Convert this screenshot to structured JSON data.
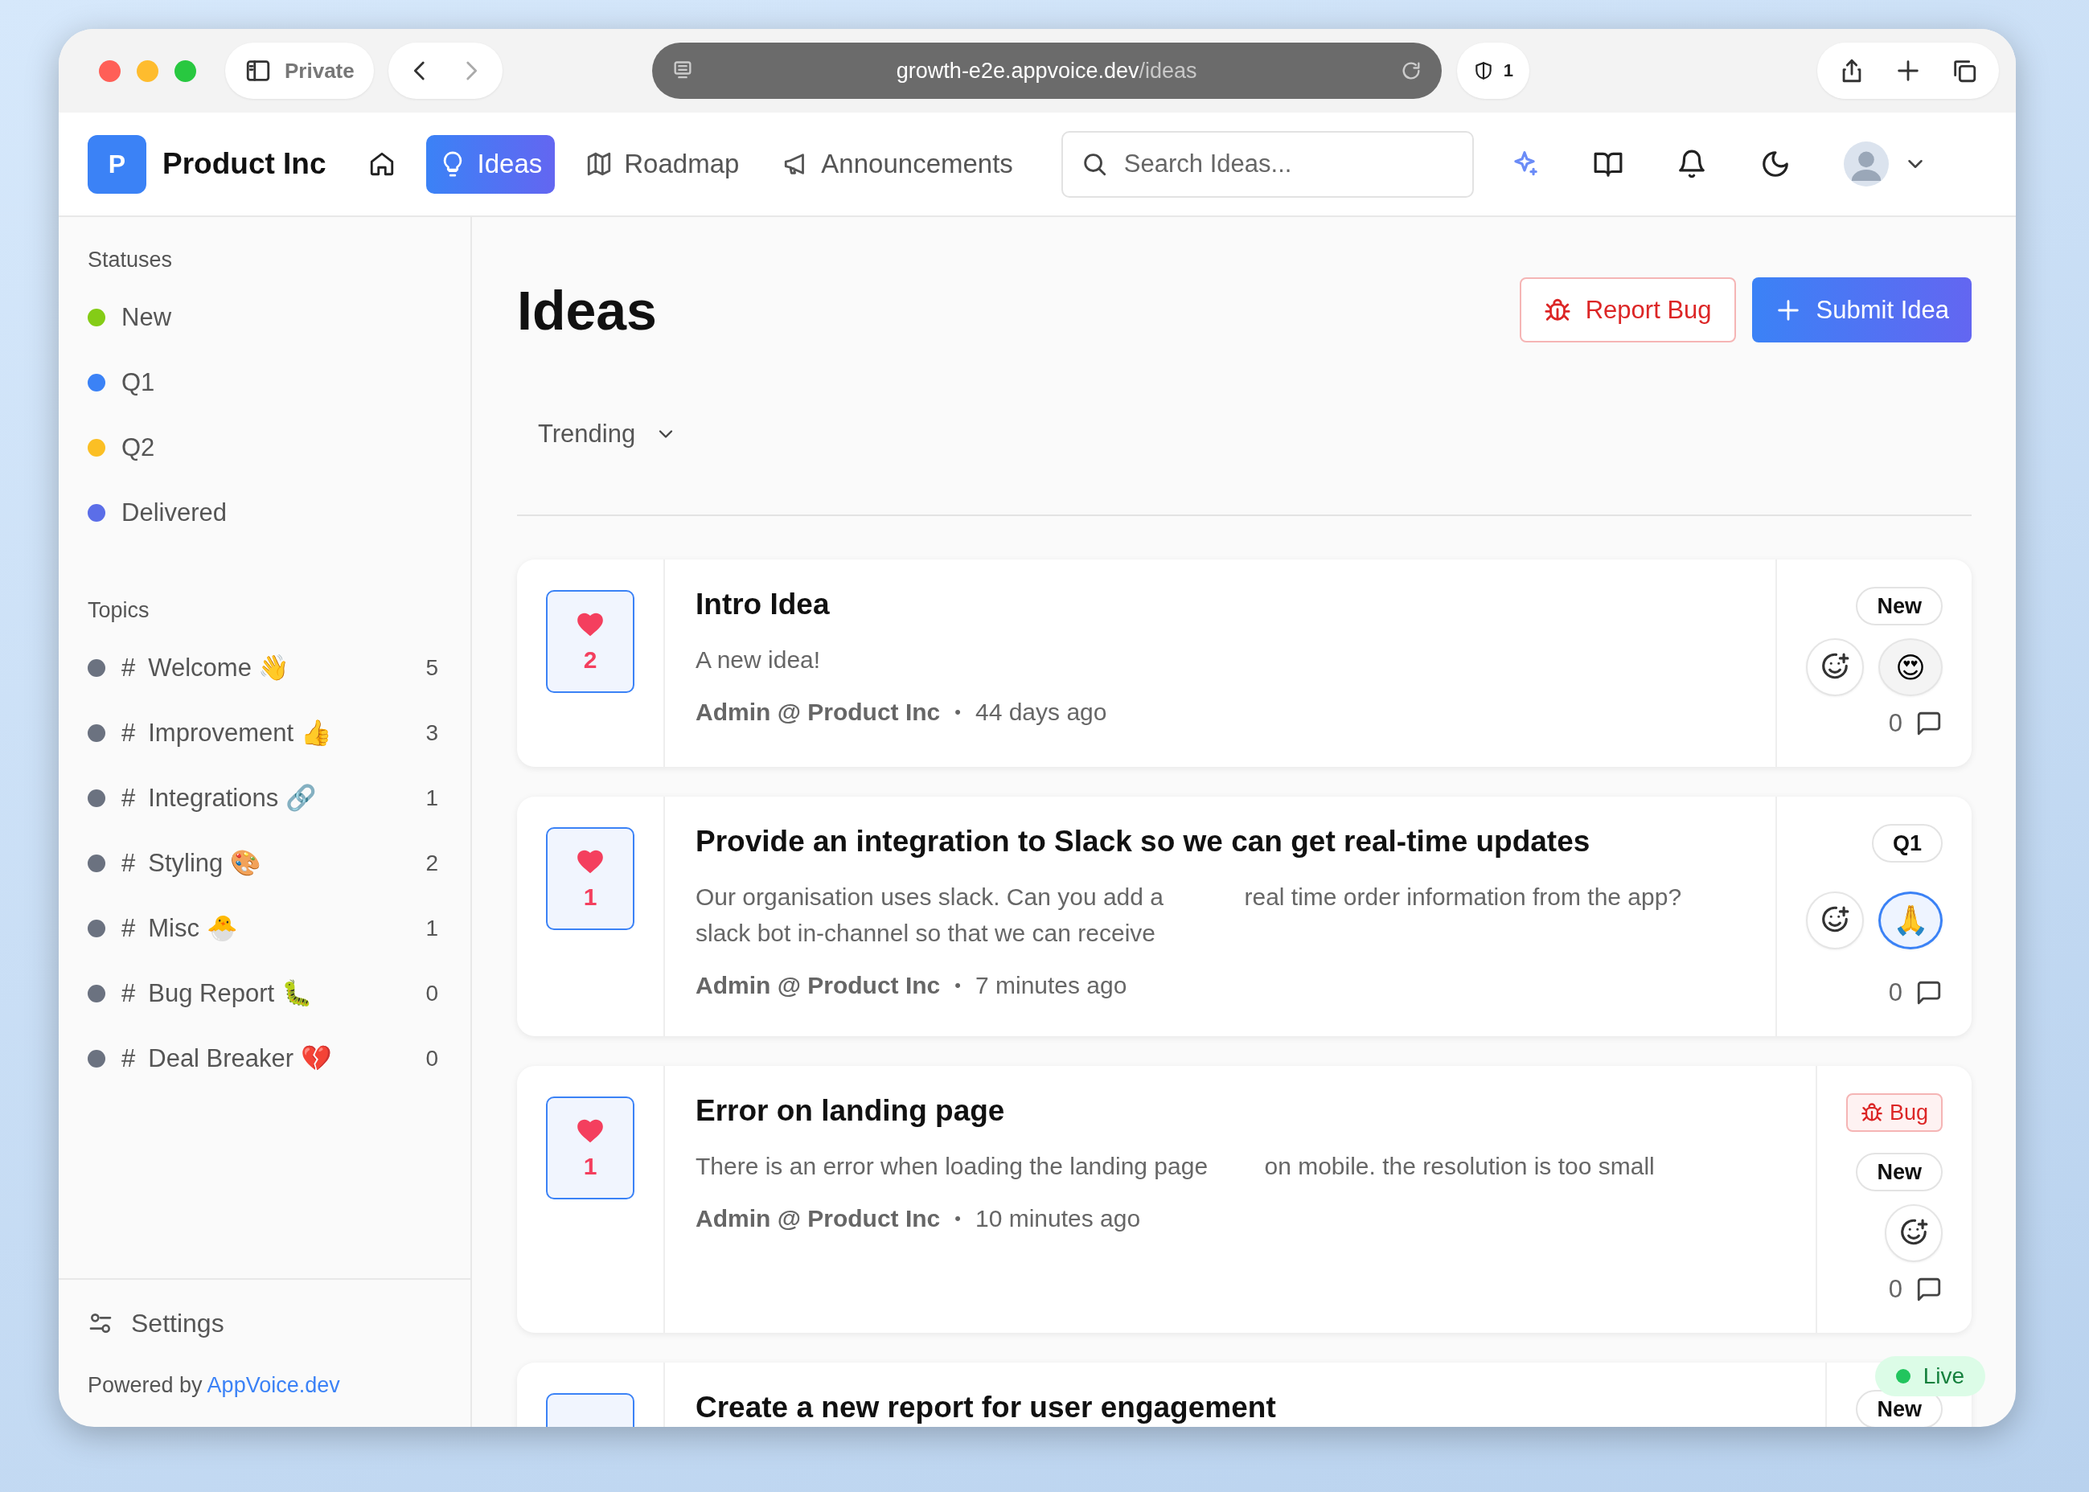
{
  "browser": {
    "private_label": "Private",
    "url_host": "growth-e2e.appvoice.dev",
    "url_path": "/ideas",
    "shield_count": "1"
  },
  "header": {
    "logo_letter": "P",
    "brand": "Product Inc",
    "nav": [
      {
        "kind": "home",
        "selected": false
      },
      {
        "kind": "ideas",
        "label": "Ideas",
        "selected": true
      },
      {
        "kind": "roadmap",
        "label": "Roadmap",
        "selected": false
      },
      {
        "kind": "announcements",
        "label": "Announcements",
        "selected": false
      }
    ],
    "search": {
      "placeholder": "Search Ideas..."
    }
  },
  "sidebar": {
    "statuses_heading": "Statuses",
    "statuses": [
      {
        "label": "New",
        "color": "#84cc16"
      },
      {
        "label": "Q1",
        "color": "#3b82f6"
      },
      {
        "label": "Q2",
        "color": "#fbbf24"
      },
      {
        "label": "Delivered",
        "color": "#5b6ee8"
      }
    ],
    "topics_heading": "Topics",
    "topics": [
      {
        "prefix": "#",
        "label": "Welcome 👋",
        "count": "5"
      },
      {
        "prefix": "#",
        "label": "Improvement 👍",
        "count": "3"
      },
      {
        "prefix": "#",
        "label": "Integrations 🔗",
        "count": "1"
      },
      {
        "prefix": "#",
        "label": "Styling 🎨",
        "count": "2"
      },
      {
        "prefix": "#",
        "label": "Misc 🐣",
        "count": "1"
      },
      {
        "prefix": "#",
        "label": "Bug Report 🐛",
        "count": "0"
      },
      {
        "prefix": "#",
        "label": "Deal Breaker 💔",
        "count": "0"
      }
    ],
    "settings": "Settings",
    "powered_by": "Powered by",
    "powered_by_link": "AppVoice.dev"
  },
  "page": {
    "title": "Ideas",
    "actions": [
      {
        "kind": "bug",
        "label": "Report Bug"
      },
      {
        "kind": "submit",
        "label": "Submit Idea"
      }
    ],
    "sort": "Trending"
  },
  "ideas": [
    {
      "votes": "2",
      "voted": true,
      "title": "Intro Idea",
      "description": "A new idea!",
      "author": "Admin @ Product Inc",
      "separator": "•",
      "time": "44 days ago",
      "tags": [
        {
          "kind": "status",
          "label": "New"
        }
      ],
      "reactions": [
        {
          "emoji": "😍",
          "selected": false
        }
      ],
      "comments": "0"
    },
    {
      "votes": "1",
      "voted": true,
      "title": "Provide an integration to Slack so we can get real-time updates",
      "description": "Our organisation uses slack. Can you add a slack bot in-channel so that we can receive real time order information from the app?",
      "author": "Admin @ Product Inc",
      "separator": "•",
      "time": "7 minutes ago",
      "tags": [
        {
          "kind": "status",
          "label": "Q1"
        }
      ],
      "reactions": [
        {
          "emoji": "🙏",
          "selected": true
        }
      ],
      "comments": "0"
    },
    {
      "votes": "1",
      "voted": true,
      "title": "Error on landing page",
      "description": "There is an error when loading the landing page on mobile. the resolution is too small",
      "author": "Admin @ Product Inc",
      "separator": "•",
      "time": "10 minutes ago",
      "tags": [
        {
          "kind": "bug",
          "label": "Bug"
        },
        {
          "kind": "status",
          "label": "New"
        }
      ],
      "comments": "0"
    },
    {
      "voted": true,
      "title": "Create a new report for user engagement",
      "tags": [
        {
          "kind": "status",
          "label": "New"
        }
      ]
    }
  ],
  "live_badge": {
    "label": "Live"
  }
}
